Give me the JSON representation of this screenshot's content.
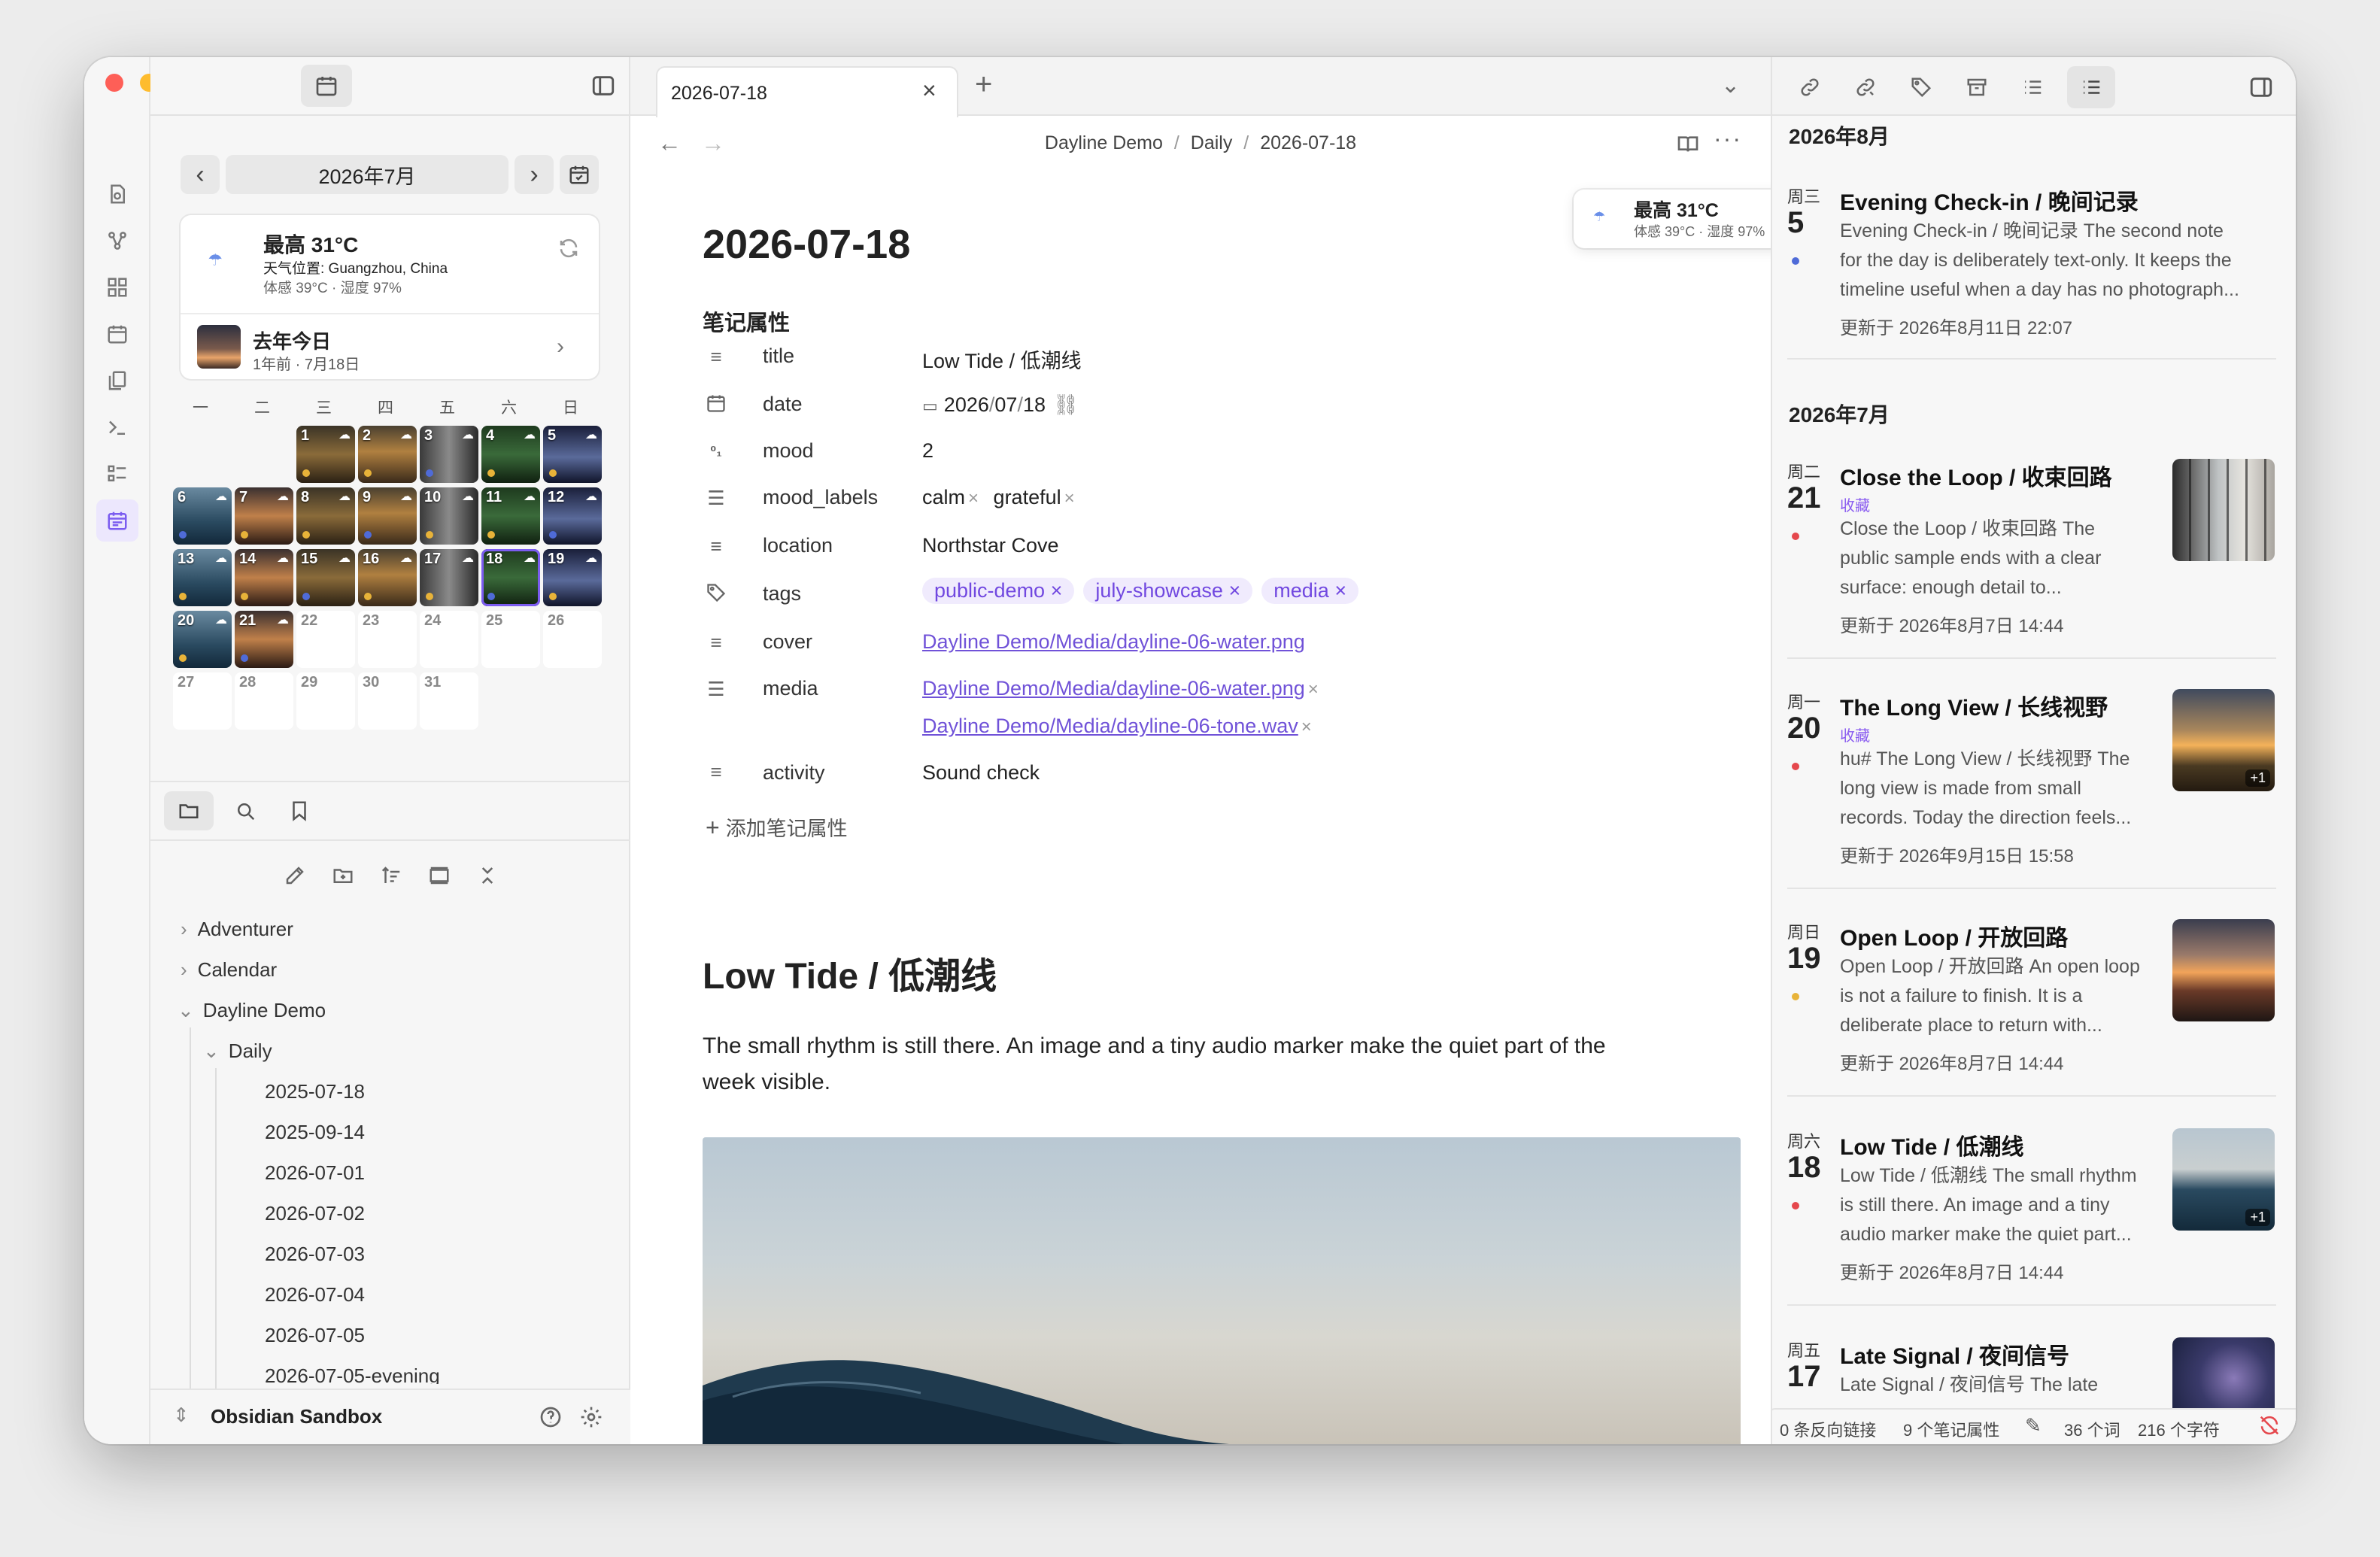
{
  "tab": {
    "title": "2026-07-18"
  },
  "breadcrumb": {
    "part1": "Dayline Demo",
    "sep": "/",
    "part2": "Daily",
    "part3": "2026-07-18"
  },
  "calendar": {
    "month_label": "2026年7月",
    "weekdays": [
      "一",
      "二",
      "三",
      "四",
      "五",
      "六",
      "日"
    ],
    "days_with_photos": [
      "1",
      "2",
      "3",
      "4",
      "5",
      "6",
      "7",
      "8",
      "9",
      "10",
      "11",
      "12",
      "13",
      "14",
      "15",
      "16",
      "17",
      "18",
      "19",
      "20",
      "21"
    ],
    "days_empty": [
      "22",
      "23",
      "24",
      "25",
      "26",
      "27",
      "28",
      "29",
      "30",
      "31"
    ],
    "selected_day": "18"
  },
  "weather": {
    "high": "最高 31°C",
    "location": "天气位置: Guangzhou, China",
    "detail": "体感 39°C · 湿度 97%"
  },
  "on_this_day": {
    "title": "去年今日",
    "sub": "1年前 · 7月18日"
  },
  "file_tree": {
    "folders": [
      "Adventurer",
      "Calendar",
      "Dayline Demo",
      "Daily"
    ],
    "files": [
      "2025-07-18",
      "2025-09-14",
      "2026-07-01",
      "2026-07-02",
      "2026-07-03",
      "2026-07-04",
      "2026-07-05",
      "2026-07-05-evening"
    ]
  },
  "vault": {
    "name": "Obsidian Sandbox"
  },
  "note": {
    "title": "2026-07-18",
    "properties_label": "笔记属性",
    "props": {
      "title_key": "title",
      "title_val": "Low Tide / 低潮线",
      "date_key": "date",
      "date_y": "2026",
      "date_m": "07",
      "date_d": "18",
      "date_sep": "/",
      "mood_key": "mood",
      "mood_val": "2",
      "mood_labels_key": "mood_labels",
      "mood_label_1": "calm",
      "mood_label_2": "grateful",
      "location_key": "location",
      "location_val": "Northstar Cove",
      "tags_key": "tags",
      "tag_1": "public-demo",
      "tag_2": "july-showcase",
      "tag_3": "media",
      "cover_key": "cover",
      "cover_val": "Dayline Demo/Media/dayline-06-water.png",
      "media_key": "media",
      "media_1": "Dayline Demo/Media/dayline-06-water.png",
      "media_2": "Dayline Demo/Media/dayline-06-tone.wav",
      "activity_key": "activity",
      "activity_val": "Sound check"
    },
    "add_property": "添加笔记属性",
    "heading": "Low Tide / 低潮线",
    "body_line1": "The small rhythm is still there. An image and a tiny audio marker make the quiet part of the",
    "body_line2": "week visible."
  },
  "floating_weather": {
    "high": "最高 31°C",
    "detail": "体感 39°C · 湿度 97%"
  },
  "timeline": {
    "aug_label": "2026年8月",
    "jul_label": "2026年7月",
    "e5": {
      "wd": "周三",
      "day": "5",
      "title": "Evening Check-in / 晚间记录",
      "ex1": "Evening Check-in / 晚间记录 The second note",
      "ex2": "for the day is deliberately text-only. It keeps the",
      "ex3": "timeline useful when a day has no photograph...",
      "up": "更新于 2026年8月11日 22:07"
    },
    "e21": {
      "wd": "周二",
      "day": "21",
      "title": "Close the Loop / 收束回路",
      "fav": "收藏",
      "ex1": "Close the Loop / 收束回路 The",
      "ex2": "public sample ends with a clear",
      "ex3": "surface: enough detail to...",
      "up": "更新于 2026年8月7日 14:44"
    },
    "e20": {
      "wd": "周一",
      "day": "20",
      "title": "The Long View / 长线视野",
      "fav": "收藏",
      "ex1": "hu# The Long View / 长线视野 The",
      "ex2": "long view is made from small",
      "ex3": "records. Today the direction feels...",
      "up": "更新于 2026年9月15日 15:58",
      "badge": "+1"
    },
    "e19": {
      "wd": "周日",
      "day": "19",
      "title": "Open Loop / 开放回路",
      "ex1": "Open Loop / 开放回路 An open loop",
      "ex2": "is not a failure to finish. It is a",
      "ex3": "deliberate place to return with...",
      "up": "更新于 2026年8月7日 14:44"
    },
    "e18": {
      "wd": "周六",
      "day": "18",
      "title": "Low Tide / 低潮线",
      "ex1": "Low Tide / 低潮线 The small rhythm",
      "ex2": "is still there. An image and a tiny",
      "ex3": "audio marker make the quiet part...",
      "up": "更新于 2026年8月7日 14:44",
      "badge": "+1"
    },
    "e17": {
      "wd": "周五",
      "day": "17",
      "title": "Late Signal / 夜间信号",
      "ex1": "Late Signal / 夜间信号 The late"
    }
  },
  "status_bar": {
    "backlinks": "0 条反向链接",
    "props": "9 个笔记属性",
    "words": "36 个词",
    "chars": "216 个字符"
  },
  "colors": {
    "accent": "#7b5cf0",
    "tag_bg": "#f0ebfd",
    "link": "#7052d8",
    "dot_red": "#e5484d",
    "dot_blue": "#4f6bd8",
    "dot_yellow": "#e8b339"
  }
}
